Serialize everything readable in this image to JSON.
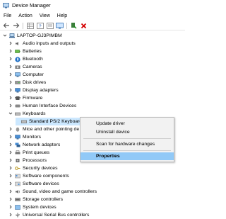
{
  "window": {
    "title": "Device Manager"
  },
  "menu": [
    "File",
    "Action",
    "View",
    "Help"
  ],
  "toolbar_icons": [
    "back-arrow-icon",
    "forward-arrow-icon",
    "properties-grid-icon",
    "help-icon",
    "show-hidden-icon",
    "monitor-scan-icon",
    "enable-device-icon",
    "uninstall-x-icon"
  ],
  "tree": {
    "root": "LAPTOP-GJ3PIMBM",
    "categories": [
      "Audio inputs and outputs",
      "Batteries",
      "Bluetooth",
      "Cameras",
      "Computer",
      "Disk drives",
      "Display adapters",
      "Firmware",
      "Human Interface Devices",
      "Keyboards",
      "Mice and other pointing de",
      "Monitors",
      "Network adapters",
      "Print queues",
      "Processors",
      "Security devices",
      "Software components",
      "Software devices",
      "Sound, video and game controllers",
      "Storage controllers",
      "System devices",
      "Universal Serial Bus controllers"
    ],
    "expanded_child": "Standard PS/2 Keyboard"
  },
  "context_menu": {
    "items": [
      "Update driver",
      "Uninstall device",
      "Scan for hardware changes",
      "Properties"
    ],
    "highlighted": "Properties"
  },
  "colors": {
    "selection": "#cce8ff",
    "menu_highlight": "#91c9f7",
    "uninstall_red": "#d40000",
    "enable_green": "#1a8a1a"
  }
}
